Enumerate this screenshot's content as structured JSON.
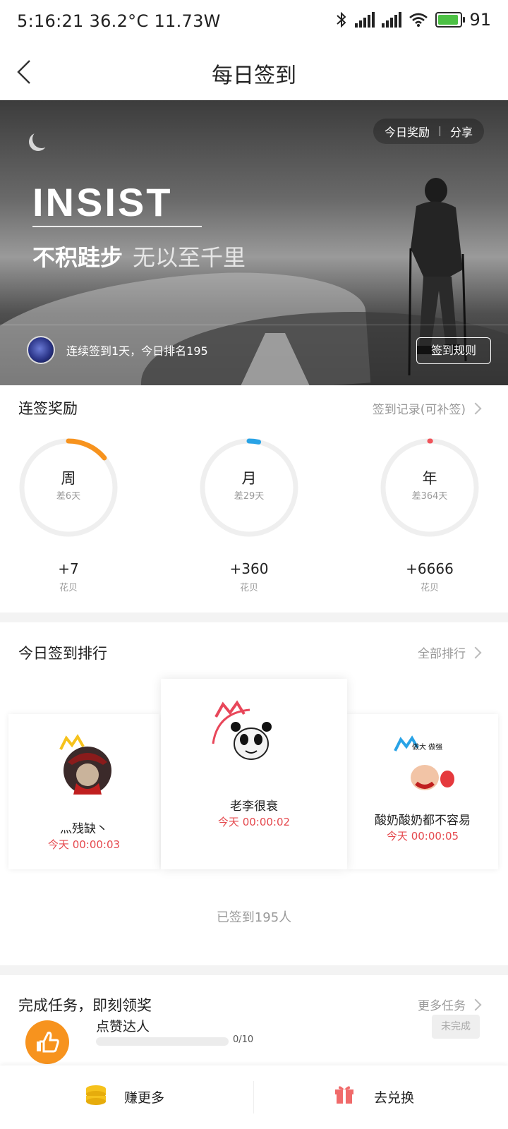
{
  "status_bar": {
    "left_text": "5:16:21 36.2°C  11.73W",
    "battery_level": "91"
  },
  "header": {
    "title": "每日签到"
  },
  "banner": {
    "reward_link": "今日奖励",
    "share_link": "分享",
    "headline": "INSIST",
    "motto_bold": "不积跬步",
    "motto_light": "无以至千里",
    "streak_text": "连续签到1天，今日排名195",
    "rules_button": "签到规则"
  },
  "streak_rewards": {
    "title": "连签奖励",
    "record_link": "签到记录(可补签)",
    "items": [
      {
        "label": "周",
        "remaining": "差6天",
        "bonus": "+7",
        "unit": "花贝",
        "progress": 0.14,
        "color": "#f7931e"
      },
      {
        "label": "月",
        "remaining": "差29天",
        "bonus": "+360",
        "unit": "花贝",
        "progress": 0.033,
        "color": "#29a3e6"
      },
      {
        "label": "年",
        "remaining": "差364天",
        "bonus": "+6666",
        "unit": "花贝",
        "progress": 0.003,
        "color": "#f0545a"
      }
    ]
  },
  "ranking": {
    "title": "今日签到排行",
    "all_link": "全部排行",
    "entries": [
      {
        "name": "灬残缺丶",
        "time": "今天 00:00:03"
      },
      {
        "name": "老李很衰",
        "time": "今天 00:00:02"
      },
      {
        "name": "酸奶酸奶都不容易",
        "time": "今天 00:00:05"
      }
    ],
    "third_avatar_caption": "做大 做强",
    "signed_count": "已签到195人"
  },
  "tasks": {
    "title": "完成任务，即刻领奖",
    "more_link": "更多任务",
    "items": [
      {
        "name": "点赞达人",
        "progress_text": "0/10",
        "progress": 0,
        "status": "未完成"
      }
    ]
  },
  "bottom_bar": {
    "earn_label": "赚更多",
    "exchange_label": "去兑换"
  }
}
